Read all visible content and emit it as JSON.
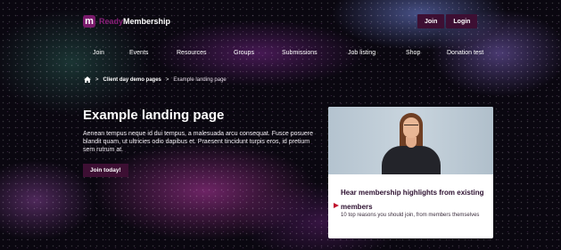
{
  "header": {
    "logo_mark": "m",
    "logo_ready": "Ready",
    "logo_brand": "Membership",
    "join_label": "Join",
    "login_label": "Login"
  },
  "nav": {
    "items": [
      "Join",
      "Events",
      "Resources",
      "Groups",
      "Submissions",
      "Job listing",
      "Shop",
      "Donation test"
    ]
  },
  "breadcrumb": {
    "parent": "Client day demo pages",
    "separator": ">",
    "current": "Example landing page"
  },
  "hero": {
    "title": "Example landing page",
    "body": "Aenean tempus neque id dui tempus, a malesuada arcu consequat. Fusce posuere blandit quam, ut ultricies odio dapibus et. Praesent tincidunt turpis eros, id pretium sem rutrum at.",
    "cta_label": "Join today!"
  },
  "card": {
    "title": "Hear membership highlights from existing members",
    "subtitle": "10 top reasons you should join, from members themselves"
  },
  "colors": {
    "accent": "#3d0f33",
    "brand": "#8a1e7a",
    "play": "#c0112e"
  },
  "icons": {
    "home": "home-icon",
    "play": "play-icon"
  }
}
